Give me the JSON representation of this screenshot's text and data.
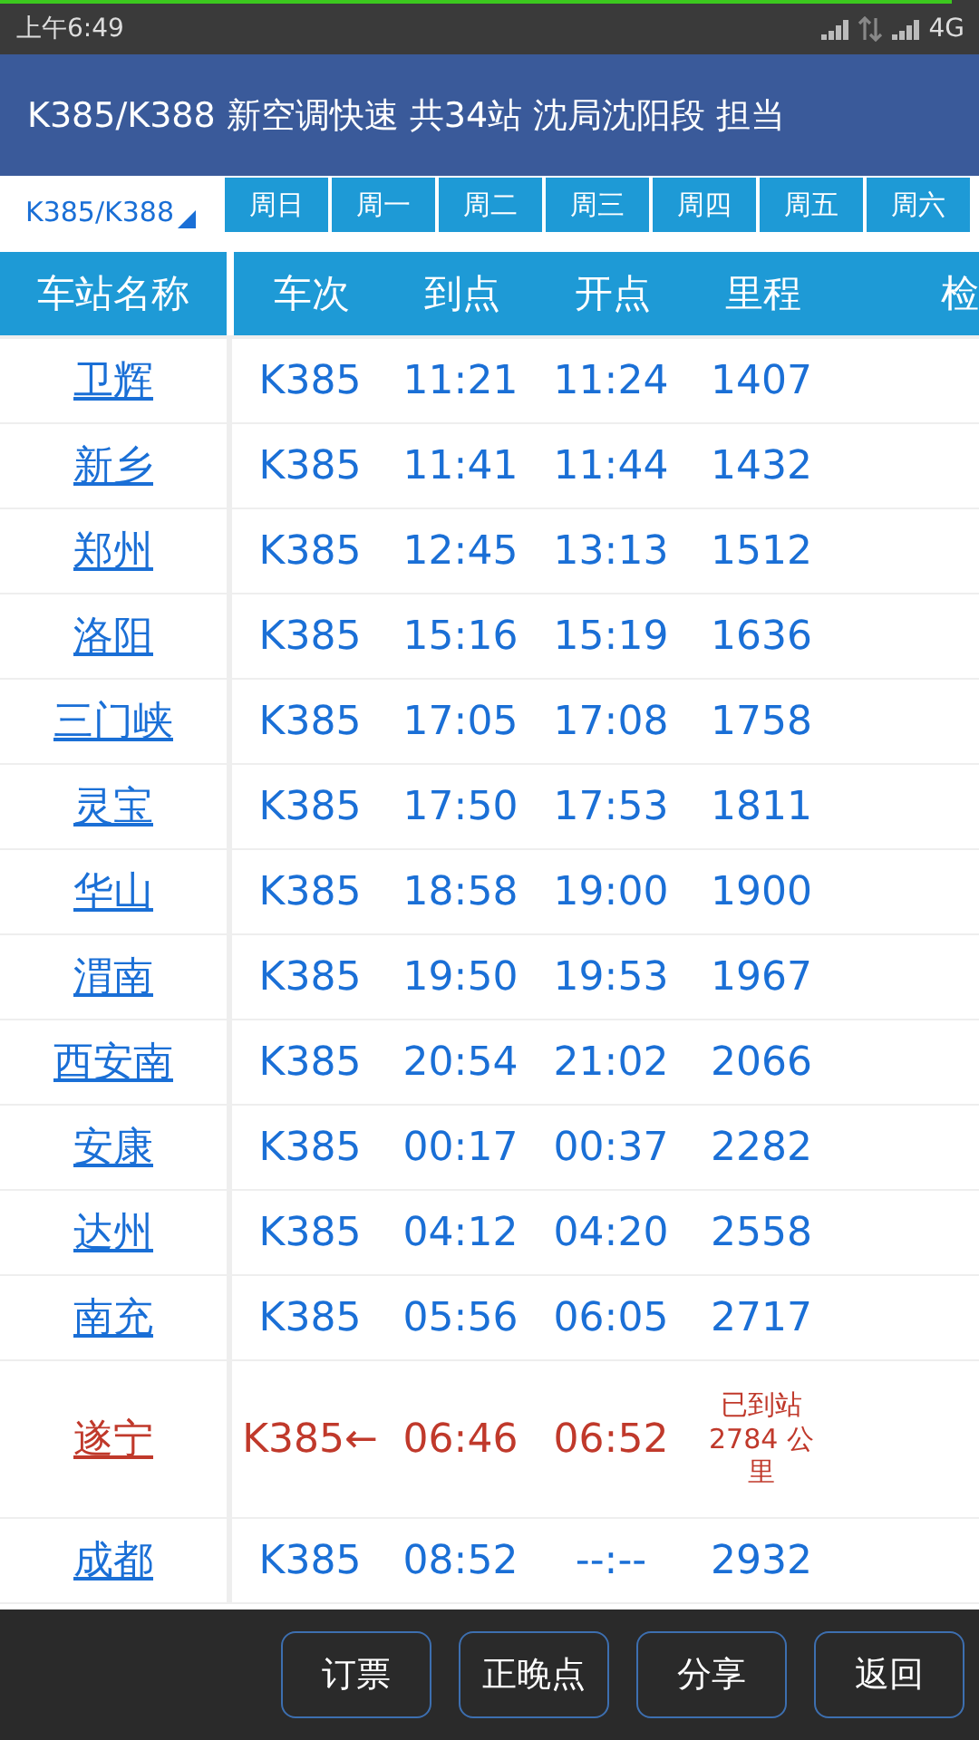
{
  "status_bar": {
    "time": "上午6:49",
    "network": "4G"
  },
  "title_bar": {
    "title": "K385/K388 新空调快速 共34站  沈局沈阳段 担当"
  },
  "train_selector": {
    "label": "K385/K388"
  },
  "day_tabs": [
    {
      "label": "周日",
      "selected": false
    },
    {
      "label": "周一",
      "selected": false
    },
    {
      "label": "周二",
      "selected": false
    },
    {
      "label": "周三",
      "selected": false
    },
    {
      "label": "周四",
      "selected": false
    },
    {
      "label": "周五",
      "selected": false
    },
    {
      "label": "周六",
      "selected": false
    }
  ],
  "table": {
    "columns": [
      "车站名称",
      "车次",
      "到点",
      "开点",
      "里程",
      "检"
    ],
    "rows": [
      {
        "station": "卫辉",
        "train": "K385",
        "arrive": "11:21",
        "depart": "11:24",
        "distance": "1407",
        "current": false
      },
      {
        "station": "新乡",
        "train": "K385",
        "arrive": "11:41",
        "depart": "11:44",
        "distance": "1432",
        "current": false
      },
      {
        "station": "郑州",
        "train": "K385",
        "arrive": "12:45",
        "depart": "13:13",
        "distance": "1512",
        "current": false
      },
      {
        "station": "洛阳",
        "train": "K385",
        "arrive": "15:16",
        "depart": "15:19",
        "distance": "1636",
        "current": false
      },
      {
        "station": "三门峡",
        "train": "K385",
        "arrive": "17:05",
        "depart": "17:08",
        "distance": "1758",
        "current": false
      },
      {
        "station": "灵宝",
        "train": "K385",
        "arrive": "17:50",
        "depart": "17:53",
        "distance": "1811",
        "current": false
      },
      {
        "station": "华山",
        "train": "K385",
        "arrive": "18:58",
        "depart": "19:00",
        "distance": "1900",
        "current": false
      },
      {
        "station": "渭南",
        "train": "K385",
        "arrive": "19:50",
        "depart": "19:53",
        "distance": "1967",
        "current": false
      },
      {
        "station": "西安南",
        "train": "K385",
        "arrive": "20:54",
        "depart": "21:02",
        "distance": "2066",
        "current": false
      },
      {
        "station": "安康",
        "train": "K385",
        "arrive": "00:17",
        "depart": "00:37",
        "distance": "2282",
        "current": false
      },
      {
        "station": "达州",
        "train": "K385",
        "arrive": "04:12",
        "depart": "04:20",
        "distance": "2558",
        "current": false
      },
      {
        "station": "南充",
        "train": "K385",
        "arrive": "05:56",
        "depart": "06:05",
        "distance": "2717",
        "current": false
      },
      {
        "station": "遂宁",
        "train": "K385←",
        "arrive": "06:46",
        "depart": "06:52",
        "distance": "已到站 2784 公里",
        "current": true
      },
      {
        "station": "成都",
        "train": "K385",
        "arrive": "08:52",
        "depart": "--:--",
        "distance": "2932",
        "current": false
      }
    ]
  },
  "buttons": [
    "订票",
    "正晚点",
    "分享",
    "返回"
  ]
}
